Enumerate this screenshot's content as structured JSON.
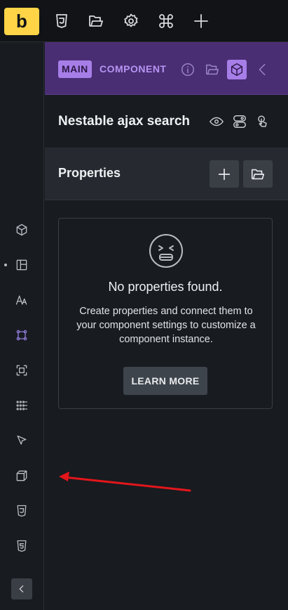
{
  "toolbar": {
    "logo": "b",
    "icons": [
      "css3-icon",
      "folder-icon",
      "gear-icon",
      "command-icon",
      "plus-icon"
    ]
  },
  "sidebar": {
    "icons": [
      "cube-icon",
      "layout-icon",
      "typography-icon",
      "component-icon",
      "frame-icon",
      "grid-dots-icon",
      "cursor-icon",
      "box-3d-icon",
      "css3-icon",
      "html5-icon"
    ],
    "active_icon": "component-icon",
    "collapse_icon": "chevron-left-icon"
  },
  "panel": {
    "badge_main": "MAIN",
    "badge_component": "COMPONENT",
    "component_name": "Nestable ajax search",
    "properties_title": "Properties",
    "empty_state": {
      "title": "No properties found.",
      "description": "Create properties and connect them to your component settings to customize a component instance.",
      "button_label": "LEARN MORE"
    }
  },
  "colors": {
    "accent": "#a77ee8",
    "header_bg": "#4a2e74",
    "logo_bg": "#ffd447",
    "annotation_arrow": "#e3161b"
  }
}
